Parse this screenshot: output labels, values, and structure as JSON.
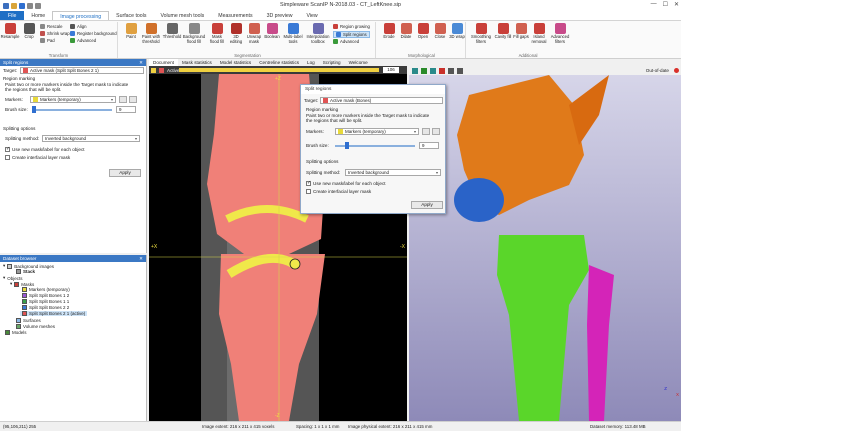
{
  "window": {
    "title": "Simpleware ScanIP N-2018.03 - CT_LeftKnee.sip",
    "minimize": "—",
    "maximize": "☐",
    "close": "✕"
  },
  "ribbon_tabs": [
    "File",
    "Home",
    "Image processing",
    "Surface tools",
    "Volume mesh tools",
    "Measurements",
    "3D preview",
    "View"
  ],
  "ribbon": {
    "groups": {
      "transform": "Transform",
      "segmentation": "Segmentation",
      "morphological": "Morphological",
      "additional": "Additional"
    },
    "buttons": {
      "resample": "Resample",
      "crop": "Crop",
      "rescale": "Rescale",
      "shrink_wrap": "Shrink wrap",
      "pad": "Pad",
      "align": "Align",
      "register_background": "Register background",
      "advanced_transform": "Advanced",
      "paint": "Paint",
      "paint_threshold": "Paint with threshold",
      "threshold": "Threshold",
      "background_flood": "Background flood fill",
      "mask_flood": "Mask flood fill",
      "editing_3d": "3D editing",
      "unwrap": "Unwrap mask",
      "boolean": "Boolean",
      "multi_label": "Multi-label tools",
      "interpolation": "Interpolation toolbox",
      "region_growing": "Region growing",
      "split_regions": "Split regions",
      "advanced_seg": "Advanced",
      "erode": "Erode",
      "dilate": "Dilate",
      "open": "Open",
      "close": "Close",
      "wrap_3d": "3D wrap",
      "smoothing": "Smoothing filters",
      "cavity_fill": "Cavity fill",
      "fill_gaps": "Fill gaps",
      "island_removal": "Island removal",
      "advanced_filters": "Advanced filters"
    }
  },
  "split_panel": {
    "title": "Split regions",
    "close": "✕",
    "target_label": "Target:",
    "target_value": "Active mask (Split Split Bones 2 1)",
    "section_region": "Region marking",
    "hint": "Paint two or more markers inside the Target mask to indicate the regions that will be split.",
    "markers_label": "Markers:",
    "markers_value": "Markers (temporary)",
    "brush_label": "Brush size:",
    "brush_value": "9",
    "section_splitting": "Splitting options",
    "method_label": "Splitting method:",
    "method_value": "Inverted background",
    "use_new_mask": "Use new mask/label for each object",
    "create_interfacial": "Create interfacial layer mask",
    "apply": "Apply"
  },
  "dataset_browser": {
    "title": "Dataset browser",
    "close": "✕",
    "items": [
      {
        "label": "Background images",
        "level": 0
      },
      {
        "label": "Stack",
        "level": 1
      },
      {
        "label": "Objects",
        "level": 0
      },
      {
        "label": "Masks",
        "level": 1
      },
      {
        "label": "Markers (temporary)",
        "level": 2,
        "color": "#e8d93a"
      },
      {
        "label": "Split Split Bones 1 2",
        "level": 2,
        "color": "#9a55d6"
      },
      {
        "label": "Split Split Bones 1 1",
        "level": 2,
        "color": "#3aa04a"
      },
      {
        "label": "Split Split Bones 2 2",
        "level": 2,
        "color": "#3a7ad6"
      },
      {
        "label": "Split Split Bones 2 1 (active)",
        "level": 2,
        "color": "#e05454"
      },
      {
        "label": "Surfaces",
        "level": 1
      },
      {
        "label": "Volume meshes",
        "level": 1
      },
      {
        "label": "Models",
        "level": 0
      }
    ]
  },
  "view_tabs": [
    "Document",
    "Mask statistics",
    "Model statistics",
    "Centreline statistics",
    "Log",
    "Scripting",
    "Welcome"
  ],
  "view2d": {
    "active_label": "Active",
    "slice_value": "106",
    "label_plus_x": "+X",
    "label_minus_x": "-X",
    "label_plus_z": "+Z",
    "label_minus_z": "-Z"
  },
  "view3d": {
    "out_of_date": "Out-of-date",
    "axis_z": "Z",
    "axis_x": "X"
  },
  "dialog": {
    "title": "Split regions",
    "target_label": "Target:",
    "target_value": "Active mask (Bones)",
    "section_region": "Region marking",
    "hint": "Paint two or more markers inside the Target mask to indicate the regions that will be split.",
    "markers_label": "Markers:",
    "markers_value": "Markers (temporary)",
    "brush_label": "Brush size:",
    "brush_value": "9",
    "section_splitting": "Splitting options",
    "method_label": "Splitting method:",
    "method_value": "Inverted background",
    "use_new_mask": "Use new mask/label for each object",
    "create_interfacial": "Create interfacial layer mask",
    "apply": "Apply"
  },
  "status": {
    "coords": "(95,106,211) 255",
    "extent": "Image extent: 216 x 211 x 415 voxels",
    "spacing": "Spacing: 1 x 1 x 1 mm",
    "physical": "Image physical extent: 216 x 211 x 415 mm",
    "memory": "Dataset memory: 113.48 MB"
  },
  "colors": {
    "accent": "#1e6fc5",
    "panel_header": "#3b78c4",
    "mask_red": "#f08078",
    "marker_yellow": "#f0e84a",
    "femur_orange": "#e07a1a",
    "patella_blue": "#2a63c8",
    "tibia_green": "#5ad62a",
    "fibula_magenta": "#d424b8"
  }
}
